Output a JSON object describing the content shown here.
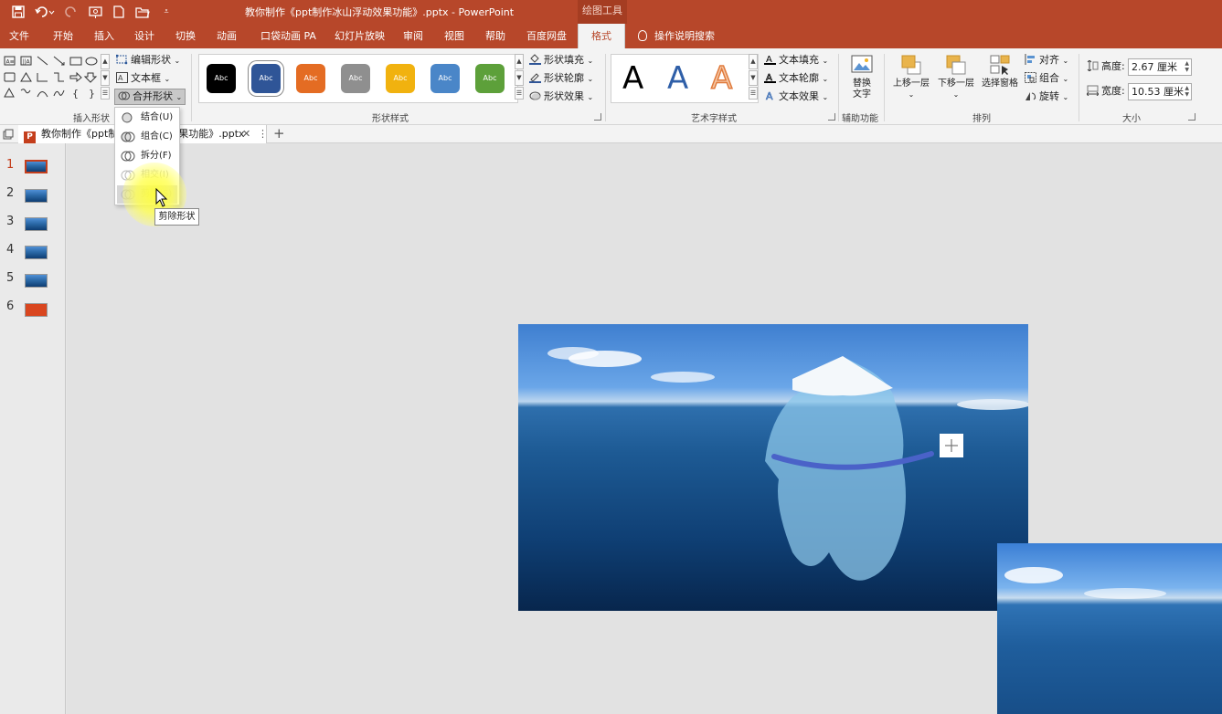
{
  "title_bar": {
    "document_title": "教你制作《ppt制作冰山浮动效果功能》.pptx  -  PowerPoint",
    "contextual_tab": "绘图工具"
  },
  "menu": {
    "tabs": [
      "文件",
      "开始",
      "插入",
      "设计",
      "切换",
      "动画",
      "口袋动画 PA",
      "幻灯片放映",
      "审阅",
      "视图",
      "帮助",
      "百度网盘",
      "格式"
    ],
    "active_tab": "格式",
    "search_label": "操作说明搜索"
  },
  "ribbon": {
    "insert_shapes": {
      "label": "插入形状",
      "edit_shape": "编辑形状",
      "text_box": "文本框",
      "merge_shapes": "合并形状"
    },
    "shape_styles": {
      "label": "形状样式",
      "presets": [
        {
          "text": "Abc",
          "color": "#000000"
        },
        {
          "text": "Abc",
          "color": "#2f5597"
        },
        {
          "text": "Abc",
          "color": "#e46c23"
        },
        {
          "text": "Abc",
          "color": "#8f8f8f"
        },
        {
          "text": "Abc",
          "color": "#f1b20f"
        },
        {
          "text": "Abc",
          "color": "#4a86c8"
        },
        {
          "text": "Abc",
          "color": "#5da03a"
        }
      ],
      "shape_fill": "形状填充",
      "shape_outline": "形状轮廓",
      "shape_effects": "形状效果"
    },
    "wordart": {
      "label": "艺术字样式",
      "letters": [
        "A",
        "A",
        "A"
      ],
      "text_fill": "文本填充",
      "text_outline": "文本轮廓",
      "text_effects": "文本效果"
    },
    "accessibility": {
      "label": "辅助功能",
      "alt_text_line1": "替换",
      "alt_text_line2": "文字"
    },
    "arrange": {
      "label": "排列",
      "bring_forward": "上移一层",
      "send_backward": "下移一层",
      "selection_pane": "选择窗格",
      "align": "对齐",
      "group": "组合",
      "rotate": "旋转"
    },
    "size": {
      "label": "大小",
      "height_label": "高度:",
      "height_value": "2.67 厘米",
      "width_label": "宽度:",
      "width_value": "10.53 厘米"
    }
  },
  "merge_menu": {
    "items": [
      {
        "label": "结合(U)",
        "enabled": true
      },
      {
        "label": "组合(C)",
        "enabled": true
      },
      {
        "label": "拆分(F)",
        "enabled": true
      },
      {
        "label": "相交(I)",
        "enabled": false
      },
      {
        "label": "剪除(S)",
        "enabled": false
      }
    ],
    "tooltip": "剪除形状"
  },
  "document_tab": {
    "label": "教你制作《ppt制作冰山浮动效果功能》.pptx",
    "close": "✕",
    "add": "+"
  },
  "slides": {
    "numbers": [
      "1",
      "2",
      "3",
      "4",
      "5",
      "6"
    ],
    "active": 1
  },
  "colors": {
    "accent": "#b7472a",
    "ribbon_bg": "#f3f3f3",
    "canvas_bg": "#e2e2e2"
  }
}
